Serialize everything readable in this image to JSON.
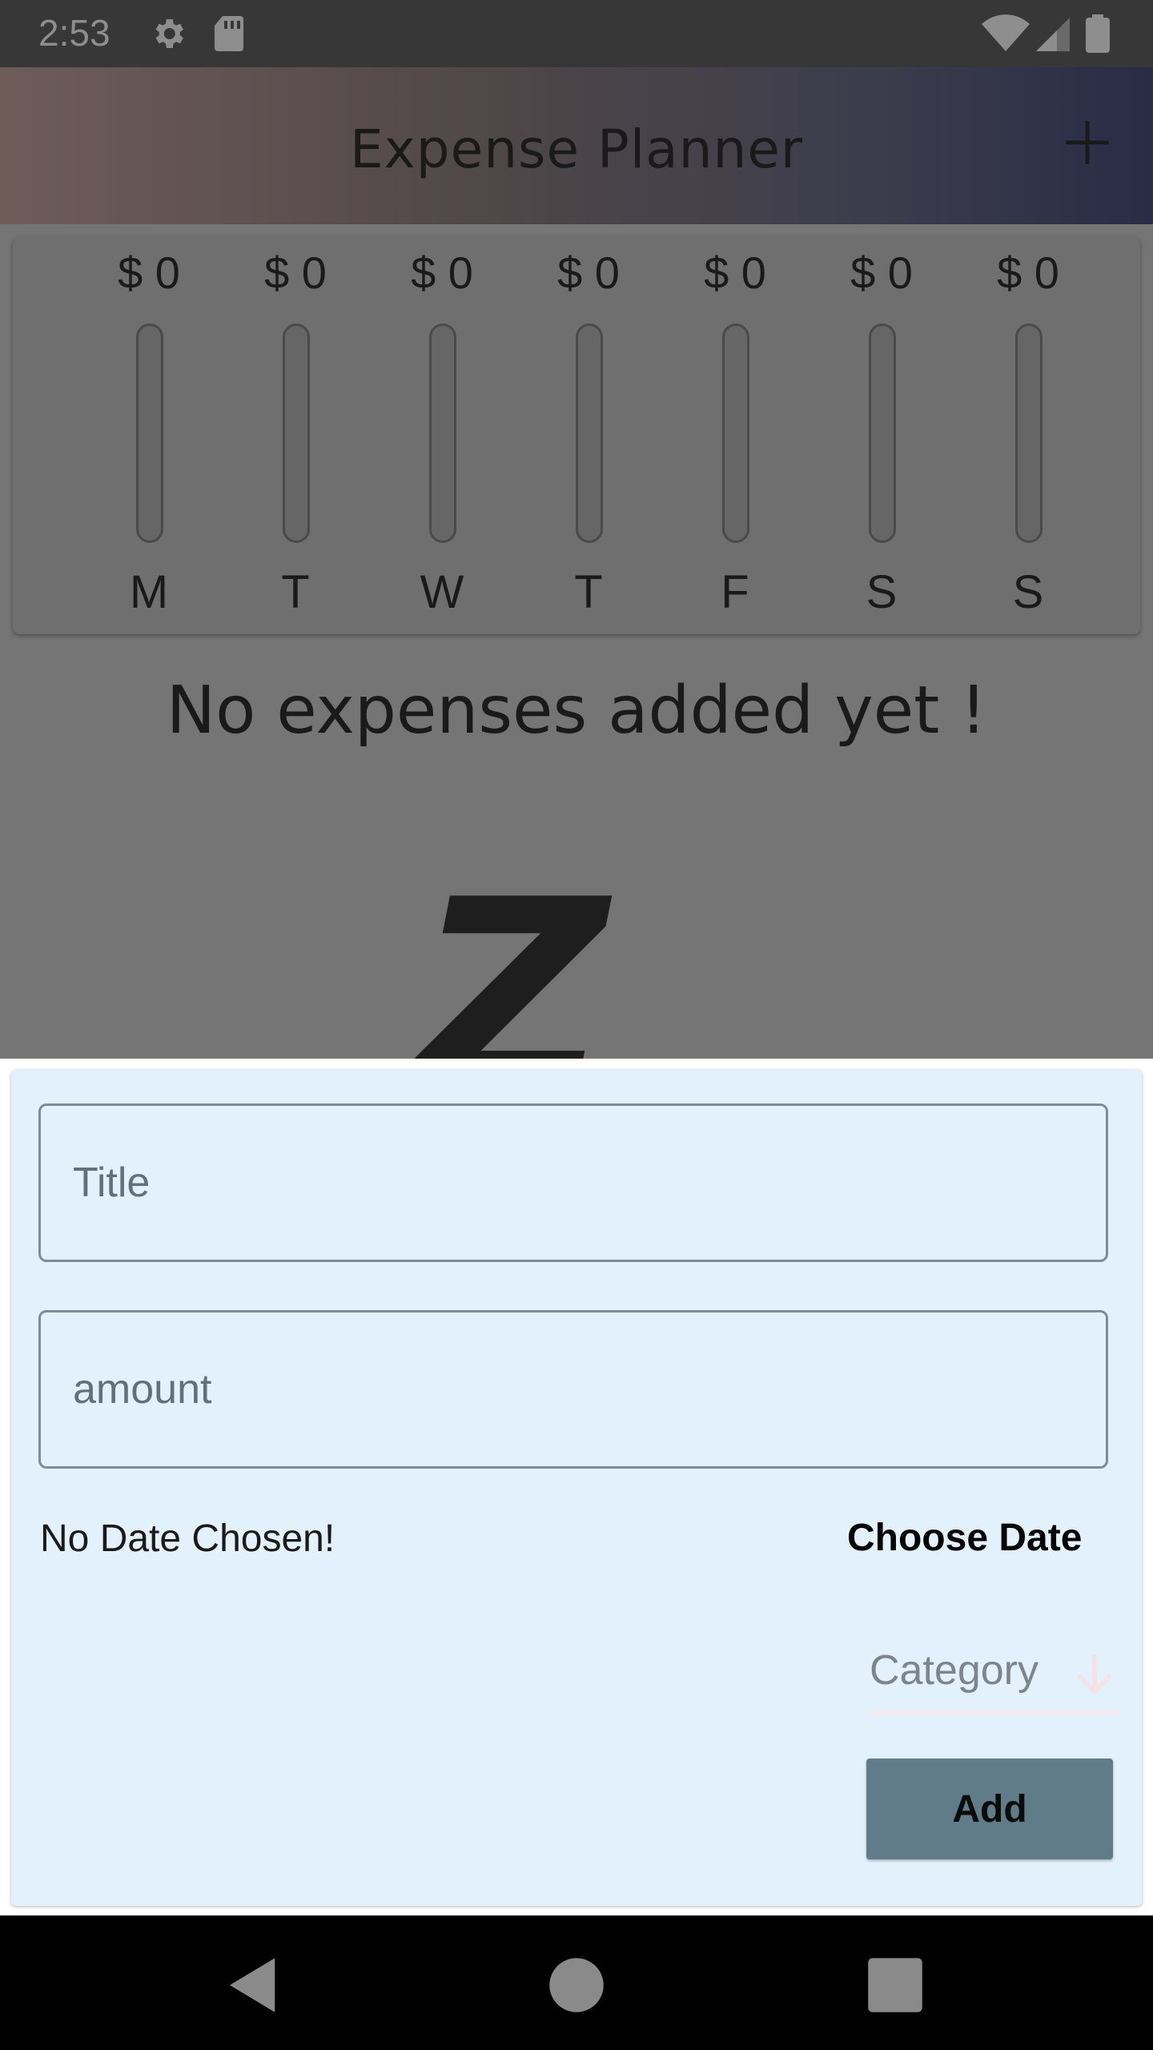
{
  "status_bar": {
    "time": "2:53",
    "icons": [
      "settings-icon",
      "sd-card-icon",
      "wifi-icon",
      "cell-signal-icon",
      "battery-icon"
    ]
  },
  "app_bar": {
    "title": "Expense Planner",
    "action_icon": "add-icon"
  },
  "chart_data": {
    "type": "bar",
    "categories": [
      "M",
      "T",
      "W",
      "T",
      "F",
      "S",
      "S"
    ],
    "values": [
      0,
      0,
      0,
      0,
      0,
      0,
      0
    ],
    "labels": [
      "$ 0",
      "$ 0",
      "$ 0",
      "$ 0",
      "$ 0",
      "$ 0",
      "$ 0"
    ]
  },
  "empty_state": {
    "message": "No expenses added yet !"
  },
  "form": {
    "title_placeholder": "Title",
    "amount_placeholder": "amount",
    "date_label": "No Date Chosen!",
    "choose_date_label": "Choose Date",
    "category_placeholder": "Category",
    "add_label": "Add"
  },
  "colors": {
    "app_bar_gradient_start": "#6e5c59",
    "app_bar_gradient_end": "#292c46",
    "sheet_background": "#e3f1fc",
    "add_button": "#5f7c88"
  },
  "nav_bar": {
    "icons": [
      "back-icon",
      "home-icon",
      "recents-icon"
    ]
  }
}
